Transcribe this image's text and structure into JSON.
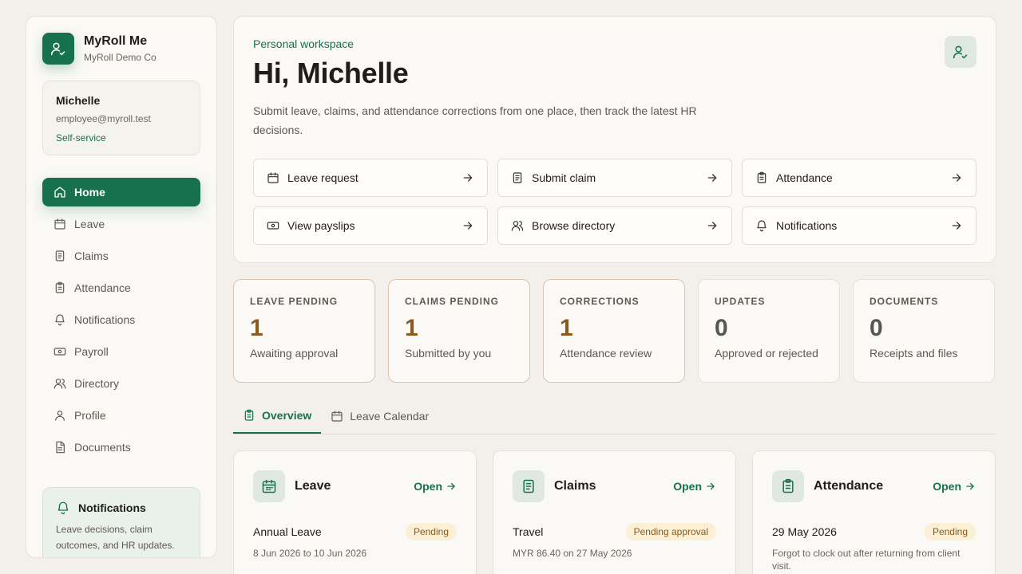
{
  "brand": {
    "title": "MyRoll Me",
    "company": "MyRoll Demo Co"
  },
  "user": {
    "name": "Michelle",
    "email": "employee@myroll.test",
    "role": "Self-service"
  },
  "nav": [
    {
      "label": "Home",
      "icon": "home-icon",
      "active": true
    },
    {
      "label": "Leave",
      "icon": "calendar-icon"
    },
    {
      "label": "Claims",
      "icon": "receipt-icon"
    },
    {
      "label": "Attendance",
      "icon": "clipboard-icon"
    },
    {
      "label": "Notifications",
      "icon": "bell-icon"
    },
    {
      "label": "Payroll",
      "icon": "banknote-icon"
    },
    {
      "label": "Directory",
      "icon": "users-icon"
    },
    {
      "label": "Profile",
      "icon": "user-icon"
    },
    {
      "label": "Documents",
      "icon": "document-icon"
    }
  ],
  "sidebar_notice": {
    "title": "Notifications",
    "text": "Leave decisions, claim outcomes, and HR updates."
  },
  "hero": {
    "eyebrow": "Personal workspace",
    "greeting": "Hi, Michelle",
    "description": "Submit leave, claims, and attendance corrections from one place, then track the latest HR decisions."
  },
  "actions": [
    {
      "label": "Leave request",
      "icon": "calendar-icon"
    },
    {
      "label": "Submit claim",
      "icon": "receipt-icon"
    },
    {
      "label": "Attendance",
      "icon": "clipboard-icon"
    },
    {
      "label": "View payslips",
      "icon": "banknote-icon"
    },
    {
      "label": "Browse directory",
      "icon": "users-icon"
    },
    {
      "label": "Notifications",
      "icon": "bell-icon"
    }
  ],
  "stats": [
    {
      "label": "LEAVE PENDING",
      "value": "1",
      "caption": "Awaiting approval",
      "highlight": true
    },
    {
      "label": "CLAIMS PENDING",
      "value": "1",
      "caption": "Submitted by you",
      "highlight": true
    },
    {
      "label": "CORRECTIONS",
      "value": "1",
      "caption": "Attendance review",
      "highlight": true
    },
    {
      "label": "UPDATES",
      "value": "0",
      "caption": "Approved or rejected",
      "highlight": false
    },
    {
      "label": "DOCUMENTS",
      "value": "0",
      "caption": "Receipts and files",
      "highlight": false
    }
  ],
  "tabs": [
    {
      "label": "Overview",
      "icon": "clipboard-icon",
      "active": true
    },
    {
      "label": "Leave Calendar",
      "icon": "calendar-icon",
      "active": false
    }
  ],
  "cards": [
    {
      "title": "Leave",
      "open": "Open",
      "item": "Annual Leave",
      "badge": "Pending",
      "sub": "8 Jun 2026 to 10 Jun 2026"
    },
    {
      "title": "Claims",
      "open": "Open",
      "item": "Travel",
      "badge": "Pending approval",
      "sub": "MYR 86.40 on 27 May 2026"
    },
    {
      "title": "Attendance",
      "open": "Open",
      "item": "29 May 2026",
      "badge": "Pending",
      "sub": "Forgot to clock out after returning from client visit."
    }
  ],
  "colors": {
    "accent": "#17704f",
    "warning_text": "#8a5a1f",
    "warning_bg": "#fbefd4",
    "background": "#f3f0eb"
  }
}
